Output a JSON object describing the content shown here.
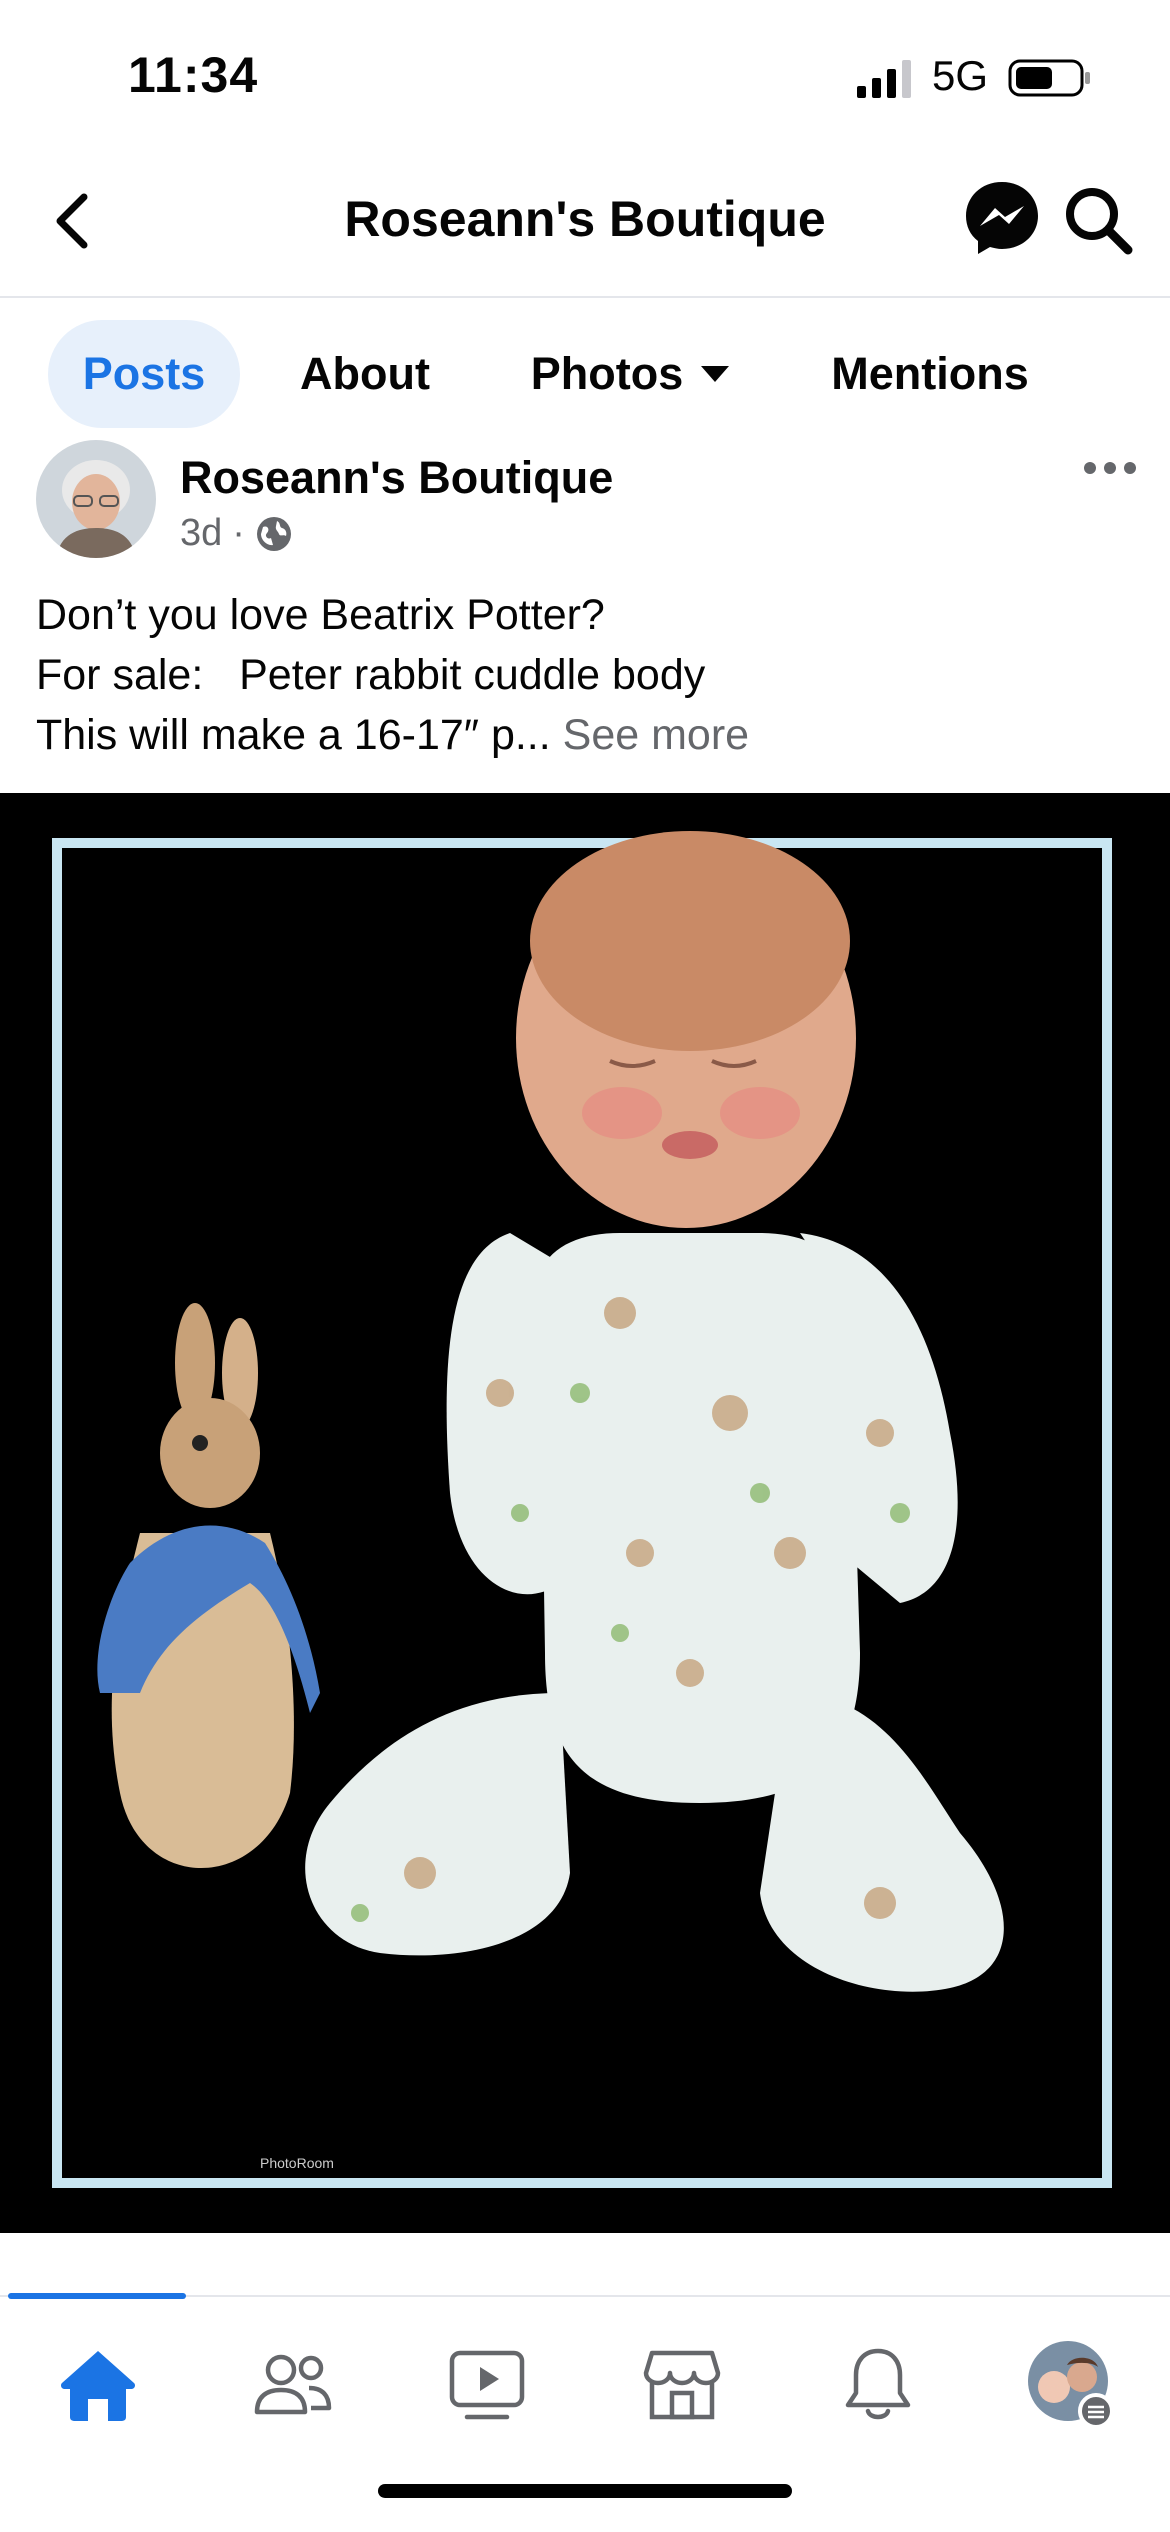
{
  "status_bar": {
    "time": "11:34",
    "network": "5G",
    "signal_bars": 3,
    "signal_icon": "cellular-signal-icon",
    "battery_icon": "battery-icon"
  },
  "header": {
    "title": "Roseann's Boutique",
    "back_icon": "chevron-left-icon",
    "messenger_icon": "messenger-icon",
    "search_icon": "search-icon"
  },
  "tabs": [
    {
      "label": "Posts",
      "active": true
    },
    {
      "label": "About",
      "active": false
    },
    {
      "label": "Photos",
      "active": false,
      "dropdown": true
    },
    {
      "label": "Mentions",
      "active": false
    }
  ],
  "post": {
    "author": "Roseann's Boutique",
    "time": "3d",
    "separator": "·",
    "privacy_icon": "globe-icon",
    "more_icon": "more-horizontal-icon",
    "text_lines": [
      "Don’t you love Beatrix Potter?",
      "For sale:   Peter rabbit cuddle body",
      "This will make a 16-17″ p... "
    ],
    "see_more": "See more",
    "photo_watermark": "PhotoRoom"
  },
  "bottom_nav": {
    "items": [
      {
        "icon": "home-icon",
        "active": true
      },
      {
        "icon": "friends-icon",
        "active": false
      },
      {
        "icon": "video-icon",
        "active": false
      },
      {
        "icon": "marketplace-icon",
        "active": false
      },
      {
        "icon": "bell-icon",
        "active": false
      },
      {
        "icon": "profile-avatar-icon",
        "active": false
      }
    ]
  },
  "colors": {
    "accent": "#1b74e4",
    "tab_active_bg": "#e7f0fb",
    "secondary_text": "#65676b",
    "divider": "#e4e6eb",
    "photo_frame": "#c9e6f2"
  }
}
